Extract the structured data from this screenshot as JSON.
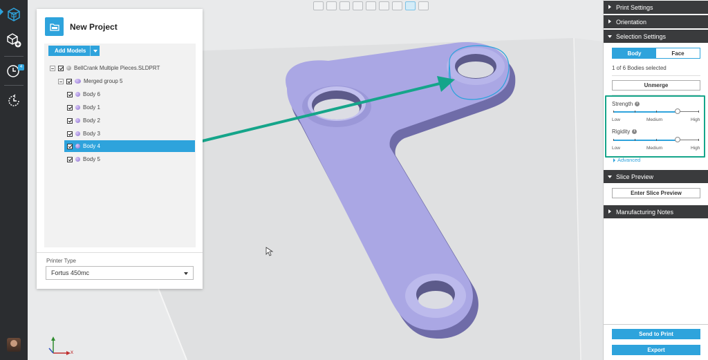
{
  "rail": {
    "items": [
      {
        "name": "model-cube-icon",
        "active": true
      },
      {
        "name": "add-model-icon"
      },
      {
        "name": "print-queue-clock-icon",
        "badge": "4"
      },
      {
        "name": "history-icon"
      }
    ]
  },
  "view_toolbar": {
    "buttons": [
      "front-view-icon",
      "back-view-icon",
      "left-view-icon",
      "right-view-icon",
      "top-view-icon",
      "bottom-view-icon",
      "iso-view-icon",
      "perspective-icon",
      "zoom-fit-icon"
    ]
  },
  "project": {
    "title": "New Project",
    "add_models_label": "Add Models",
    "tree": [
      {
        "label": "BellCrank Multiple Pieces.SLDPRT",
        "level": 0,
        "type": "file"
      },
      {
        "label": "Merged group 5",
        "level": 1,
        "type": "group"
      },
      {
        "label": "Body 6",
        "level": 2,
        "type": "body"
      },
      {
        "label": "Body 1",
        "level": 2,
        "type": "body"
      },
      {
        "label": "Body 2",
        "level": 2,
        "type": "body"
      },
      {
        "label": "Body 3",
        "level": 2,
        "type": "body"
      },
      {
        "label": "Body 4",
        "level": 2,
        "type": "body",
        "selected": true
      },
      {
        "label": "Body 5",
        "level": 2,
        "type": "body"
      }
    ],
    "printer_type_label": "Printer Type",
    "printer_type_value": "Fortus 450mc"
  },
  "right_panel": {
    "sections": {
      "print_settings": "Print Settings",
      "orientation": "Orientation",
      "selection_settings": "Selection Settings",
      "slice_preview": "Slice Preview",
      "manufacturing_notes": "Manufacturing Notes"
    },
    "selection": {
      "tab_body": "Body",
      "tab_face": "Face",
      "bodies_selected": "1 of 6 Bodies selected",
      "unmerge_label": "Unmerge",
      "strength_label": "Strength",
      "rigidity_label": "Rigidity",
      "scale_low": "Low",
      "scale_medium": "Medium",
      "scale_high": "High",
      "strength_level": 0.75,
      "rigidity_level": 0.75,
      "advanced_label": "Advanced"
    },
    "enter_slice_preview_label": "Enter Slice Preview",
    "send_to_print_label": "Send to Print",
    "export_label": "Export"
  },
  "axes": {
    "x_label": "x"
  },
  "colors": {
    "accent": "#2ea3dc",
    "part": "#a9a6e3",
    "annotation": "#15a58a"
  }
}
